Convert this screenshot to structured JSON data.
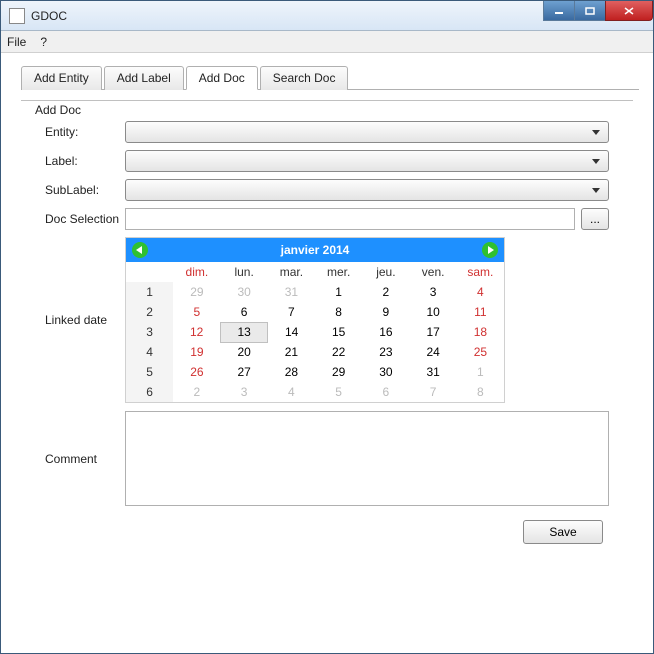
{
  "window": {
    "title": "GDOC"
  },
  "menu": {
    "file": "File",
    "help": "?"
  },
  "tabs": {
    "items": [
      {
        "label": "Add Entity",
        "active": false
      },
      {
        "label": "Add Label",
        "active": false
      },
      {
        "label": "Add Doc",
        "active": true
      },
      {
        "label": "Search Doc",
        "active": false
      }
    ]
  },
  "form": {
    "legend": "Add Doc",
    "entity_label": "Entity:",
    "label_label": "Label:",
    "sublabel_label": "SubLabel:",
    "docsel_label": "Doc Selection",
    "docsel_value": "",
    "browse_label": "...",
    "linked_label": "Linked date",
    "comment_label": "Comment",
    "comment_value": "",
    "save_label": "Save"
  },
  "calendar": {
    "header": "janvier   2014",
    "daynames": [
      "",
      "dim.",
      "lun.",
      "mar.",
      "mer.",
      "jeu.",
      "ven.",
      "sam."
    ],
    "weeks": [
      {
        "wk": "1",
        "days": [
          {
            "n": "29",
            "cls": "other"
          },
          {
            "n": "30",
            "cls": "other"
          },
          {
            "n": "31",
            "cls": "other"
          },
          {
            "n": "1"
          },
          {
            "n": "2"
          },
          {
            "n": "3"
          },
          {
            "n": "4",
            "cls": "sat"
          }
        ]
      },
      {
        "wk": "2",
        "days": [
          {
            "n": "5",
            "cls": "sun"
          },
          {
            "n": "6"
          },
          {
            "n": "7"
          },
          {
            "n": "8"
          },
          {
            "n": "9"
          },
          {
            "n": "10"
          },
          {
            "n": "11",
            "cls": "sat"
          }
        ]
      },
      {
        "wk": "3",
        "days": [
          {
            "n": "12",
            "cls": "sun"
          },
          {
            "n": "13",
            "cls": "sel"
          },
          {
            "n": "14"
          },
          {
            "n": "15"
          },
          {
            "n": "16"
          },
          {
            "n": "17"
          },
          {
            "n": "18",
            "cls": "sat"
          }
        ]
      },
      {
        "wk": "4",
        "days": [
          {
            "n": "19",
            "cls": "sun"
          },
          {
            "n": "20"
          },
          {
            "n": "21"
          },
          {
            "n": "22"
          },
          {
            "n": "23"
          },
          {
            "n": "24"
          },
          {
            "n": "25",
            "cls": "sat"
          }
        ]
      },
      {
        "wk": "5",
        "days": [
          {
            "n": "26",
            "cls": "sun"
          },
          {
            "n": "27"
          },
          {
            "n": "28"
          },
          {
            "n": "29"
          },
          {
            "n": "30"
          },
          {
            "n": "31"
          },
          {
            "n": "1",
            "cls": "other"
          }
        ]
      },
      {
        "wk": "6",
        "days": [
          {
            "n": "2",
            "cls": "other"
          },
          {
            "n": "3",
            "cls": "other"
          },
          {
            "n": "4",
            "cls": "other"
          },
          {
            "n": "5",
            "cls": "other"
          },
          {
            "n": "6",
            "cls": "other"
          },
          {
            "n": "7",
            "cls": "other"
          },
          {
            "n": "8",
            "cls": "other"
          }
        ]
      }
    ]
  }
}
